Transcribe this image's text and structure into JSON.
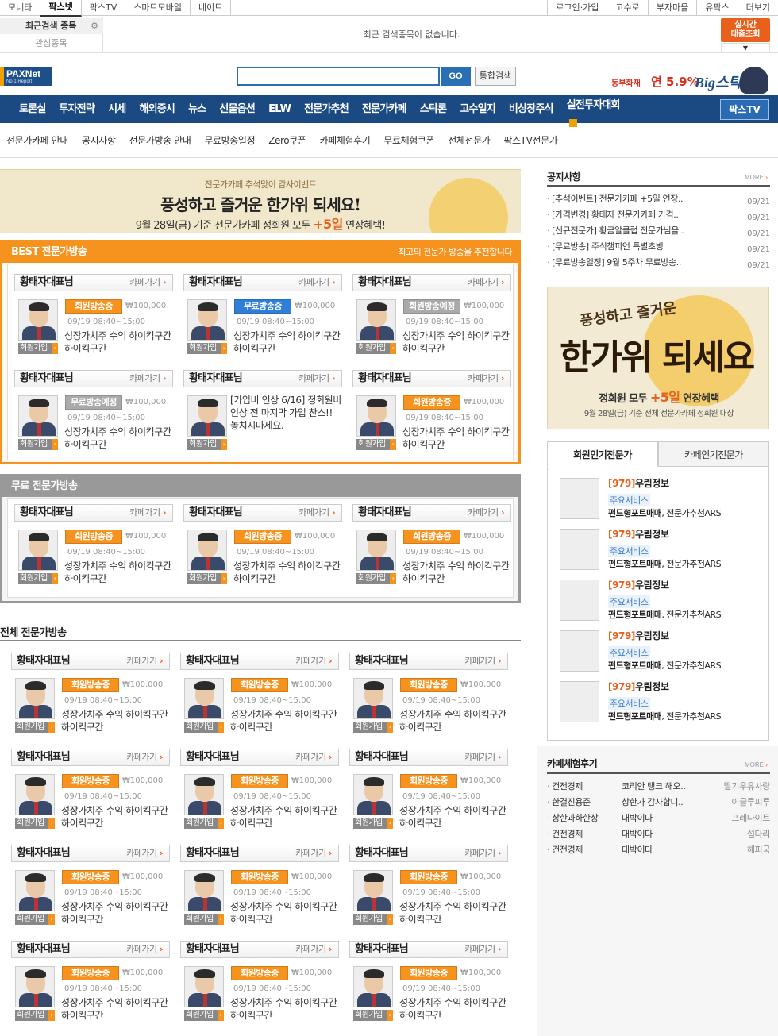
{
  "topbar": {
    "sites": [
      "모네타",
      "팍스넷",
      "팍스TV",
      "스마트모바일",
      "네이트"
    ],
    "active_site": "팍스넷",
    "util": [
      "로그인·가입",
      "고수로",
      "부자마을",
      "유팍스",
      "더보기"
    ]
  },
  "recent": {
    "tab_recent": "최근검색 종목",
    "tab_interest": "관심종목",
    "empty_message": "최근 검색종목이 없습니다.",
    "realtime_btn": [
      "실시간",
      "대출조회"
    ]
  },
  "logo": {
    "text": "PAXNet",
    "sub": "No.1 Report"
  },
  "search": {
    "placeholder": "",
    "go": "GO",
    "total": "통합검색"
  },
  "ad": {
    "company": "동부화재",
    "rate": "연 5.9%",
    "product": "Big스탁론"
  },
  "nav": {
    "items": [
      "토론실",
      "투자전략",
      "시세",
      "해외증시",
      "뉴스",
      "선물옵션",
      "ELW",
      "전문가추천",
      "전문가카페",
      "스탁론",
      "고수일지",
      "비상장주식",
      "실전투자대회"
    ],
    "new_badge": "N",
    "paxtv": "팍스TV"
  },
  "subnav": [
    "전문가카페 안내",
    "공지사항",
    "전문가방송 안내",
    "무료방송일정",
    "Zero쿠폰",
    "카페체험후기",
    "무료체험쿠폰",
    "전체전문가",
    "팍스TV전문가"
  ],
  "banner": {
    "line1": "전문가카페 추석맞이 감사이벤트",
    "line2": "풍성하고 즐거운 한가위 되세요!",
    "line3_pre": "9월 28일(금) 기준 전문가카페 정회원 모두 ",
    "line3_em": "+5일",
    "line3_post": " 연장혜택!"
  },
  "best": {
    "title": "BEST 전문가방송",
    "subtitle": "최고의 전문가 방송을 추천합니다"
  },
  "free": {
    "title": "무료 전문가방송"
  },
  "all": {
    "title": "전체 전문가방송"
  },
  "card_common": {
    "name": "황태자대표님",
    "cafe_go": "카페가기",
    "price": "₩100,000",
    "time": "09/19 08:40~15:00",
    "desc": "성장가치주 수익 하이킥구간 하이킥구간",
    "join": "회원가입"
  },
  "badges": {
    "member_live": "회원방송중",
    "free_live": "무료방송중",
    "member_sched": "회원방송예정",
    "free_sched": "무료방송예정"
  },
  "special_desc": "[가입비 인상 6/16] 정회원비 인상 전 마지막 가입 찬스!! 놓치지마세요.",
  "notice": {
    "title": "공지사항",
    "more": "MORE",
    "items": [
      {
        "text": "[추석이벤트] 전문가카페 +5일 연장..",
        "date": "09/21"
      },
      {
        "text": "[가격변경] 황태자 전문가카페 가격..",
        "date": "09/21"
      },
      {
        "text": "[신규전문가] 황금알클럽 전문가님을..",
        "date": "09/21"
      },
      {
        "text": "[무료방송] 주식챔피언 특별초빙",
        "date": "09/21"
      },
      {
        "text": "[무료방송일정] 9월 5주차 무료방송..",
        "date": "09/21"
      }
    ]
  },
  "rbanner": {
    "line1": "풍성하고 즐거운",
    "line2": "한가위 되세요",
    "line3_pre": "정회원 모두 ",
    "line3_em": "+5일",
    "line3_post": " 연장혜택",
    "line4": "9월 28일(금) 기준 전체 전문가카페 정회원 대상"
  },
  "popular": {
    "tab1": "회원인기전문가",
    "tab2": "카페인기전문가",
    "rank": "[979]",
    "name": "우림정보",
    "service_label": "주요서비스",
    "service_bold": "펀드형포트매매",
    "service_rest": ", 전문가추천ARS"
  },
  "reviews": {
    "title": "카페체험후기",
    "more": "MORE",
    "items": [
      {
        "cafe": "건전경제",
        "text": "코리안 탱크 해오..",
        "user": "딸기우유사랑"
      },
      {
        "cafe": "한결진용준",
        "text": "상한가 감사합니..",
        "user": "이글루피루"
      },
      {
        "cafe": "상한과하한상",
        "text": "대박이다",
        "user": "프레나이트"
      },
      {
        "cafe": "건전경제",
        "text": "대박이다",
        "user": "섭다리"
      },
      {
        "cafe": "건전경제",
        "text": "대박이다",
        "user": "해피국"
      }
    ]
  }
}
